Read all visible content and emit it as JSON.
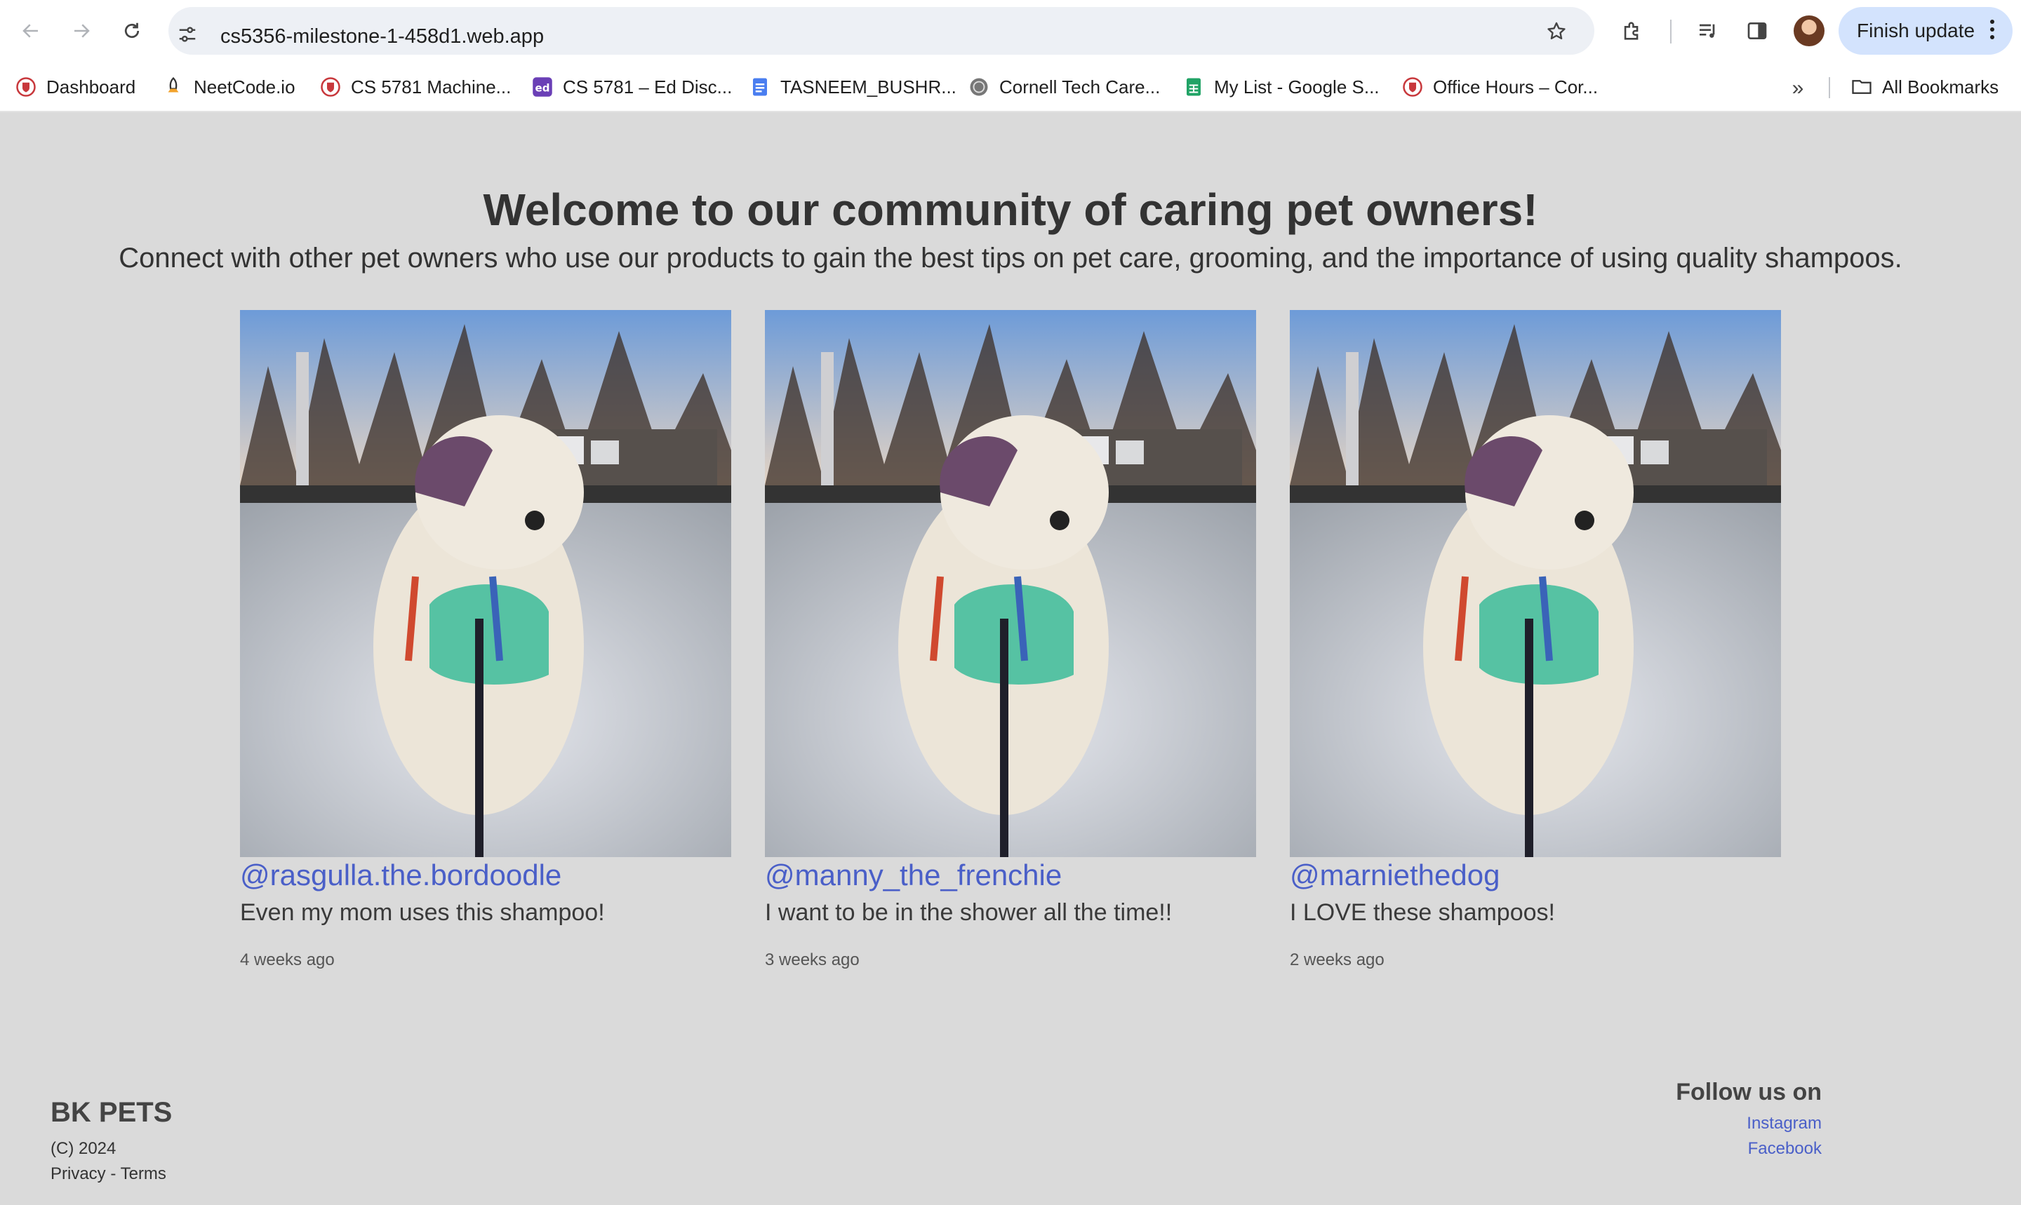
{
  "browser": {
    "url": "cs5356-milestone-1-458d1.web.app",
    "update_button": "Finish update",
    "bookmarks": [
      {
        "label": "Dashboard",
        "icon": "cornell-shield-icon"
      },
      {
        "label": "NeetCode.io",
        "icon": "rocket-icon"
      },
      {
        "label": "CS 5781 Machine...",
        "icon": "cornell-shield-icon"
      },
      {
        "label": "CS 5781 – Ed Disc...",
        "icon": "ed-icon"
      },
      {
        "label": "TASNEEM_BUSHR...",
        "icon": "google-docs-icon"
      },
      {
        "label": "Cornell Tech Care...",
        "icon": "seal-icon"
      },
      {
        "label": "My List - Google S...",
        "icon": "google-sheets-icon"
      },
      {
        "label": "Office Hours – Cor...",
        "icon": "cornell-shield-icon"
      }
    ],
    "all_bookmarks": "All Bookmarks"
  },
  "hero": {
    "title": "Welcome to our community of caring pet owners!",
    "subtitle": "Connect with other pet owners who use our products to gain the best tips on pet care, grooming, and the importance of using quality shampoos."
  },
  "posts": [
    {
      "handle": "@rasgulla.the.bordoodle",
      "comment": "Even my mom uses this shampoo!",
      "time": "4 weeks ago"
    },
    {
      "handle": "@manny_the_frenchie",
      "comment": "I want to be in the shower all the time!!",
      "time": "3 weeks ago"
    },
    {
      "handle": "@marniethedog",
      "comment": "I LOVE these shampoos!",
      "time": "2 weeks ago"
    }
  ],
  "footer": {
    "brand": "BK PETS",
    "copyright": "(C) 2024",
    "privacy": "Privacy",
    "separator": " - ",
    "terms": "Terms",
    "follow_heading": "Follow us on",
    "instagram": "Instagram",
    "facebook": "Facebook"
  },
  "colors": {
    "page_background": "#dadada",
    "link": "#4a5fc8",
    "update_button": "#d3e3fd"
  }
}
